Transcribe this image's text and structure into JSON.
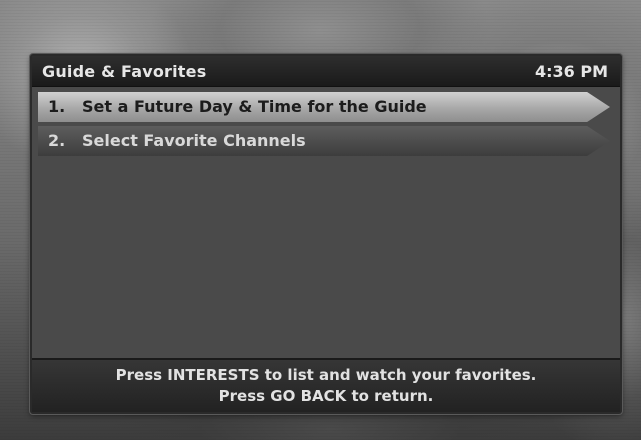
{
  "header": {
    "title": "Guide & Favorites",
    "time": "4:36 PM"
  },
  "menu": {
    "items": [
      {
        "number": "1.",
        "label": "Set a Future Day & Time for the Guide",
        "selected": true
      },
      {
        "number": "2.",
        "label": "Select Favorite Channels",
        "selected": false
      }
    ]
  },
  "help": {
    "line1": "Press INTERESTS to list and watch your favorites.",
    "line2": "Press GO BACK to return."
  }
}
